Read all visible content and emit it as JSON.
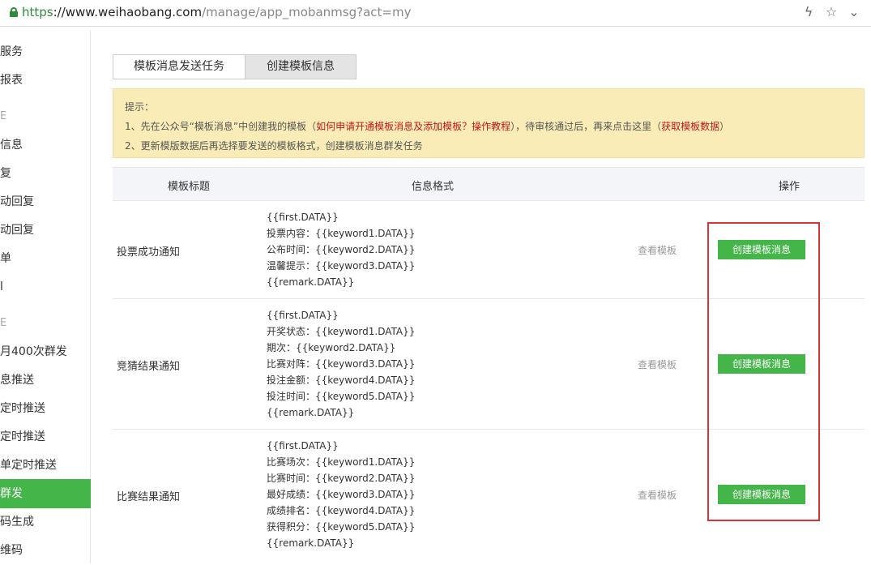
{
  "address_bar": {
    "scheme": "https",
    "host": "://www.weihaobang.com",
    "path": "/manage/app_mobanmsg?act=my"
  },
  "sidebar": {
    "items": [
      {
        "label": "服务"
      },
      {
        "label": "报表"
      },
      {
        "label": "E"
      },
      {
        "label": "信息"
      },
      {
        "label": "复"
      },
      {
        "label": "动回复"
      },
      {
        "label": "动回复"
      },
      {
        "label": "单"
      },
      {
        "label": "l"
      },
      {
        "label": "E"
      },
      {
        "label": "月400次群发"
      },
      {
        "label": "息推送"
      },
      {
        "label": "定时推送"
      },
      {
        "label": "定时推送"
      },
      {
        "label": "单定时推送"
      },
      {
        "label": "群发"
      },
      {
        "label": "码生成"
      },
      {
        "label": "维码"
      }
    ],
    "active_index": 15
  },
  "tabs": [
    {
      "label": "模板消息发送任务"
    },
    {
      "label": "创建模板信息"
    }
  ],
  "notice": {
    "line0": "提示：",
    "line1_a": "1、先在公众号“模板消息”中创建我的模板（",
    "line1_link1": "如何申请开通模板消息及添加模板？操作教程",
    "line1_b": "），待审核通过后，再来点击这里（",
    "line1_link2": "获取模板数据",
    "line1_c": "）",
    "line2": "2、更新模版数据后再选择要发送的模板格式，创建模板消息群发任务"
  },
  "table": {
    "headers": {
      "title": "模板标题",
      "format": "信息格式",
      "action": "操作"
    },
    "view_label": "查看模板",
    "create_label": "创建模板消息",
    "rows": [
      {
        "title": "投票成功通知",
        "fields": [
          "{{first.DATA}}",
          "投票内容：{{keyword1.DATA}}",
          "公布时间：{{keyword2.DATA}}",
          "温馨提示：{{keyword3.DATA}}",
          "{{remark.DATA}}"
        ]
      },
      {
        "title": "竞猜结果通知",
        "fields": [
          "{{first.DATA}}",
          "开奖状态：{{keyword1.DATA}}",
          "期次：{{keyword2.DATA}}",
          "比赛对阵：{{keyword3.DATA}}",
          "投注金额：{{keyword4.DATA}}",
          "投注时间：{{keyword5.DATA}}",
          "{{remark.DATA}}"
        ]
      },
      {
        "title": "比赛结果通知",
        "fields": [
          "{{first.DATA}}",
          "比赛场次：{{keyword1.DATA}}",
          "比赛时间：{{keyword2.DATA}}",
          "最好成绩：{{keyword3.DATA}}",
          "成绩排名：{{keyword4.DATA}}",
          "获得积分：{{keyword5.DATA}}",
          "{{remark.DATA}}"
        ]
      }
    ]
  },
  "colors": {
    "accent": "#44b549",
    "notice_bg": "#faecb7",
    "link_red": "#c0161a",
    "highlight": "#d9323a"
  }
}
